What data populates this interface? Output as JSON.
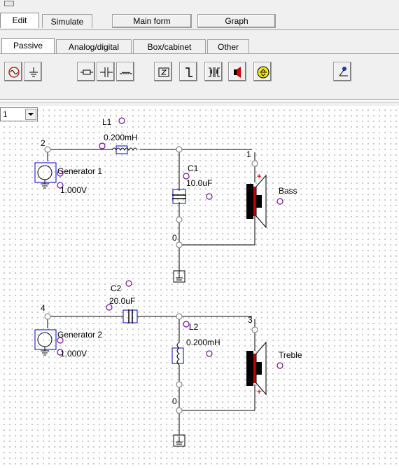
{
  "top_tabs": [
    {
      "label": "Edit",
      "active": true
    },
    {
      "label": "Simulate",
      "active": false
    }
  ],
  "top_buttons": [
    {
      "label": "Main form"
    },
    {
      "label": "Graph"
    }
  ],
  "component_tabs": [
    {
      "label": "Passive",
      "active": true
    },
    {
      "label": "Analog/digital",
      "active": false
    },
    {
      "label": "Box/cabinet",
      "active": false
    },
    {
      "label": "Other",
      "active": false
    }
  ],
  "toolbar_icons": [
    "generator-icon",
    "ground-icon",
    "resistor-icon",
    "capacitor-icon",
    "inductor-icon",
    "impedance-icon",
    "switch-icon",
    "transformer-icon",
    "speaker-icon",
    "port-icon",
    "probe-icon"
  ],
  "page_selector": {
    "value": "1"
  },
  "circuit": {
    "top": {
      "node_in": "2",
      "node_out": "1",
      "node_gnd": "0",
      "inductor_name": "L1",
      "inductor_value": "0.200mH",
      "capacitor_name": "C1",
      "capacitor_value": "10.0uF",
      "generator_name": "Generator 1",
      "generator_value": "1.000V",
      "speaker_name": "Bass"
    },
    "bottom": {
      "node_in": "4",
      "node_out": "3",
      "node_gnd": "0",
      "capacitor_name": "C2",
      "capacitor_value": "20.0uF",
      "inductor_name": "L2",
      "inductor_value": "0.200mH",
      "generator_name": "Generator 2",
      "generator_value": "1.000V",
      "speaker_name": "Treble"
    }
  },
  "colors": {
    "wire": "#000000",
    "handle": "#7a0aa0",
    "selection": "#0000cc",
    "speaker_red": "#ff0000"
  }
}
